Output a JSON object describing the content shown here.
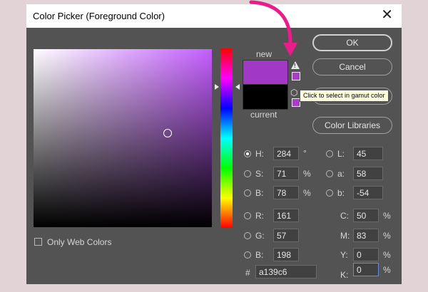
{
  "dialog": {
    "title": "Color Picker (Foreground Color)",
    "close_icon": "close-icon"
  },
  "swatches": {
    "new_label": "new",
    "current_label": "current",
    "new_color": "#a139c6",
    "current_color": "#000000",
    "gamut_warning_icon": "warning-triangle-icon",
    "websafe_icon": "cube-icon"
  },
  "tooltip": "Click to select in gamut color",
  "buttons": {
    "ok": "OK",
    "cancel": "Cancel",
    "color_libraries": "Color Libraries"
  },
  "hsb": [
    {
      "label": "H:",
      "value": "284",
      "unit": "°",
      "selected": true
    },
    {
      "label": "S:",
      "value": "71",
      "unit": "%",
      "selected": false
    },
    {
      "label": "B:",
      "value": "78",
      "unit": "%",
      "selected": false
    }
  ],
  "lab": [
    {
      "label": "L:",
      "value": "45"
    },
    {
      "label": "a:",
      "value": "58"
    },
    {
      "label": "b:",
      "value": "-54"
    }
  ],
  "rgb": [
    {
      "label": "R:",
      "value": "161"
    },
    {
      "label": "G:",
      "value": "57"
    },
    {
      "label": "B:",
      "value": "198"
    }
  ],
  "cmyk": [
    {
      "label": "C:",
      "value": "50",
      "unit": "%"
    },
    {
      "label": "M:",
      "value": "83",
      "unit": "%"
    },
    {
      "label": "Y:",
      "value": "0",
      "unit": "%"
    },
    {
      "label": "K:",
      "value": "0",
      "unit": "%"
    }
  ],
  "hex": {
    "label": "#",
    "value": "a139c6"
  },
  "only_web_colors": {
    "label": "Only Web Colors",
    "checked": false
  },
  "colors": {
    "accent_arrow": "#ea1c8b",
    "dialog_bg": "#535353"
  }
}
